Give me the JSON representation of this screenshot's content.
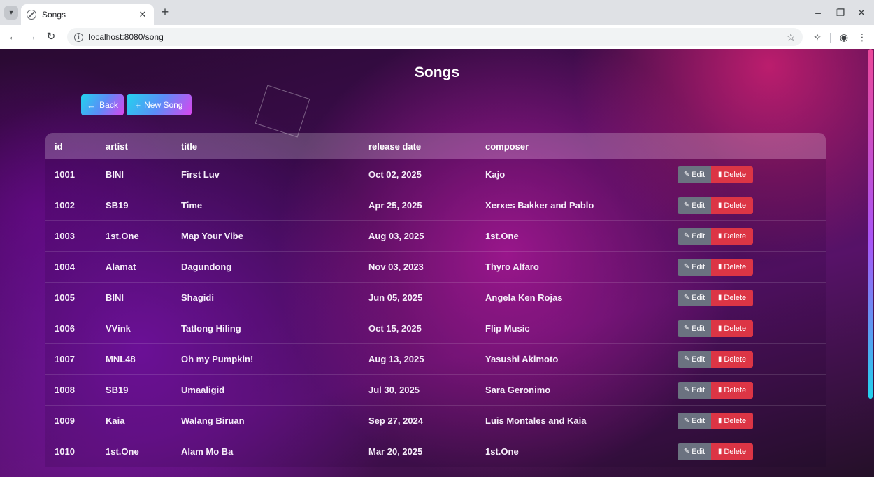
{
  "browser": {
    "tab_title": "Songs",
    "url": "localhost:8080/song"
  },
  "page": {
    "title": "Songs",
    "back_label": "Back",
    "new_label": "New Song"
  },
  "table": {
    "headers": [
      "id",
      "artist",
      "title",
      "release date",
      "composer"
    ],
    "edit_label": "Edit",
    "delete_label": "Delete",
    "rows": [
      {
        "id": "1001",
        "artist": "BINI",
        "title": "First Luv",
        "date": "Oct 02, 2025",
        "composer": "Kajo"
      },
      {
        "id": "1002",
        "artist": "SB19",
        "title": "Time",
        "date": "Apr 25, 2025",
        "composer": "Xerxes Bakker and Pablo"
      },
      {
        "id": "1003",
        "artist": "1st.One",
        "title": "Map Your Vibe",
        "date": "Aug 03, 2025",
        "composer": "1st.One"
      },
      {
        "id": "1004",
        "artist": "Alamat",
        "title": "Dagundong",
        "date": "Nov 03, 2023",
        "composer": "Thyro Alfaro"
      },
      {
        "id": "1005",
        "artist": "BINI",
        "title": "Shagidi",
        "date": "Jun 05, 2025",
        "composer": "Angela Ken Rojas"
      },
      {
        "id": "1006",
        "artist": "VVink",
        "title": "Tatlong Hiling",
        "date": "Oct 15, 2025",
        "composer": "Flip Music"
      },
      {
        "id": "1007",
        "artist": "MNL48",
        "title": "Oh my Pumpkin!",
        "date": "Aug 13, 2025",
        "composer": "Yasushi Akimoto"
      },
      {
        "id": "1008",
        "artist": "SB19",
        "title": "Umaaligid",
        "date": "Jul 30, 2025",
        "composer": "Sara Geronimo"
      },
      {
        "id": "1009",
        "artist": "Kaia",
        "title": "Walang Biruan",
        "date": "Sep 27, 2024",
        "composer": "Luis Montales and Kaia"
      },
      {
        "id": "1010",
        "artist": "1st.One",
        "title": "Alam Mo Ba",
        "date": "Mar 20, 2025",
        "composer": "1st.One"
      }
    ]
  },
  "icons": {
    "back": "arrow-left-icon",
    "new": "plus-icon",
    "edit": "pencil-icon",
    "delete": "trash-icon"
  },
  "colors": {
    "edit_button": "#6b7280",
    "delete_button": "#dc3545",
    "accent_cyan": "#22d3ee",
    "accent_magenta": "#d946ef"
  }
}
